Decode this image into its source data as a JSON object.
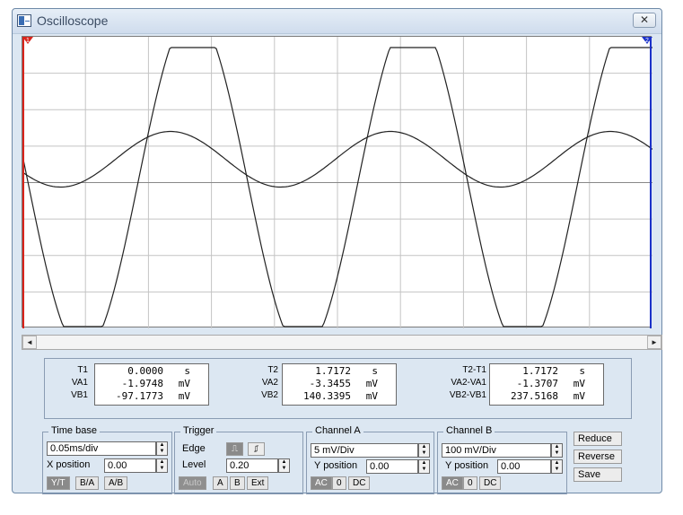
{
  "window": {
    "title": "Oscilloscope",
    "close_glyph": "✕"
  },
  "screen": {
    "markers": [
      {
        "id": "1",
        "color": "#d9241c"
      },
      {
        "id": "2",
        "color": "#1a31c9"
      }
    ],
    "grid_divisions": {
      "x": 10,
      "y": 8
    }
  },
  "scrollbar": {
    "left_arrow": "◄",
    "right_arrow": "►"
  },
  "readout": {
    "col1": {
      "labels": [
        "T1",
        "VA1",
        "VB1"
      ],
      "values": [
        "0.0000",
        "-1.9748",
        "-97.1773"
      ],
      "units": [
        "s",
        "mV",
        "mV"
      ]
    },
    "col2": {
      "labels": [
        "T2",
        "VA2",
        "VB2"
      ],
      "values": [
        "1.7172",
        "-3.3455",
        "140.3395"
      ],
      "units": [
        "s",
        "mV",
        "mV"
      ]
    },
    "col3": {
      "labels": [
        "T2-T1",
        "VA2-VA1",
        "VB2-VB1"
      ],
      "values": [
        "1.7172",
        "-1.3707",
        "237.5168"
      ],
      "units": [
        "s",
        "mV",
        "mV"
      ]
    }
  },
  "timebase": {
    "label": "Time base",
    "value": "0.05ms/div",
    "xpos_label": "X position",
    "xpos_value": "0.00",
    "modes": [
      "Y/T",
      "B/A",
      "A/B"
    ]
  },
  "trigger": {
    "label": "Trigger",
    "edge_label": "Edge",
    "level_label": "Level",
    "level_value": "0.20",
    "edge_rising": "⎍",
    "edge_falling": "⎎",
    "sources": [
      "Auto",
      "A",
      "B",
      "Ext"
    ]
  },
  "channel_a": {
    "label": "Channel A",
    "scale": "5 mV/Div",
    "ypos_label": "Y position",
    "ypos_value": "0.00",
    "coupling": [
      "AC",
      "0",
      "DC"
    ]
  },
  "channel_b": {
    "label": "Channel B",
    "scale": "100 mV/Div",
    "ypos_label": "Y position",
    "ypos_value": "0.00",
    "coupling": [
      "AC",
      "0",
      "DC"
    ]
  },
  "actions": {
    "reduce": "Reduce",
    "reverse": "Reverse",
    "save": "Save"
  },
  "colors": {
    "window_bg": "#dce7f2",
    "trace": "#222222",
    "grid": "#c4c4c4"
  }
}
